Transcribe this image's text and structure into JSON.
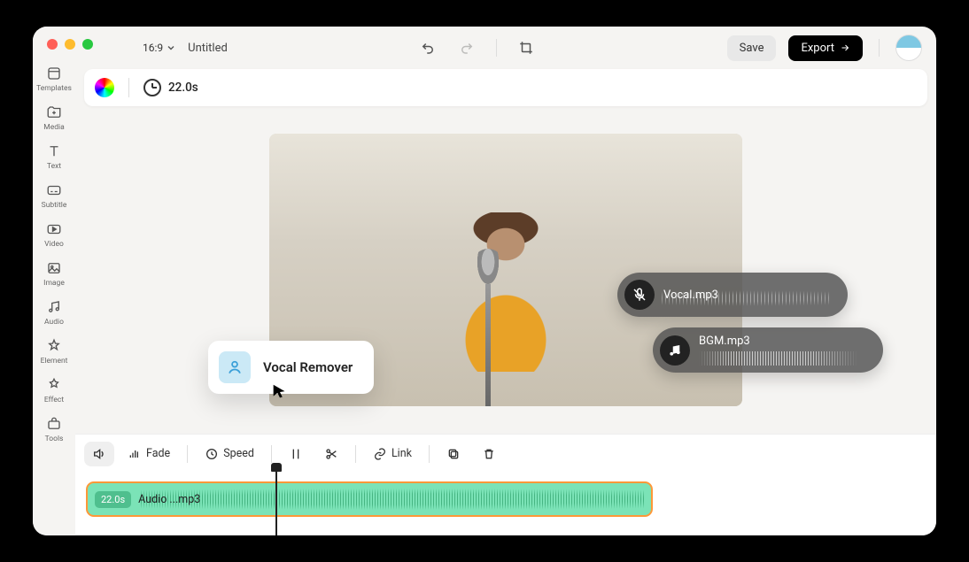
{
  "window": {
    "title": "Untitled"
  },
  "topbar": {
    "ratio": "16:9",
    "save": "Save",
    "export": "Export"
  },
  "subbar": {
    "duration": "22.0s"
  },
  "sidebar": [
    {
      "id": "templates",
      "label": "Templates"
    },
    {
      "id": "media",
      "label": "Media"
    },
    {
      "id": "text",
      "label": "Text"
    },
    {
      "id": "subtitle",
      "label": "Subtitle"
    },
    {
      "id": "video",
      "label": "Video"
    },
    {
      "id": "image",
      "label": "Image"
    },
    {
      "id": "audio",
      "label": "Audio"
    },
    {
      "id": "element",
      "label": "Element"
    },
    {
      "id": "effect",
      "label": "Effect"
    },
    {
      "id": "tools",
      "label": "Tools"
    }
  ],
  "context_menu": {
    "vocal_remover": "Vocal Remover"
  },
  "overlays": {
    "vocal": "Vocal.mp3",
    "bgm": "BGM.mp3"
  },
  "tools": {
    "fade": "Fade",
    "speed": "Speed",
    "link": "Link"
  },
  "timeline": {
    "clip_time": "22.0s",
    "clip_name": "Audio ...mp3"
  }
}
